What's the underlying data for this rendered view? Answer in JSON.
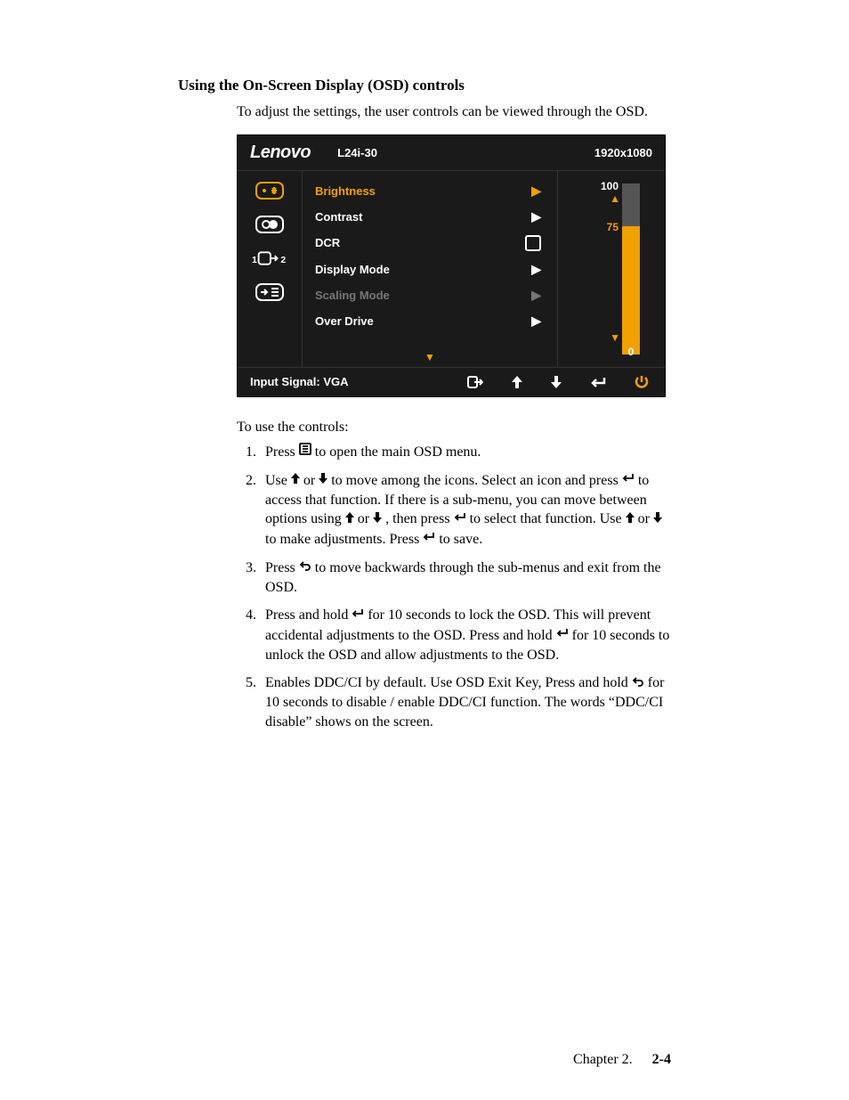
{
  "section_title": "Using the On-Screen Display (OSD) controls",
  "intro": "To adjust the settings, the user controls can be viewed through the OSD.",
  "osd": {
    "logo": "Lenovo",
    "model": "L24i-30",
    "resolution": "1920x1080",
    "menu": [
      {
        "label": "Brightness",
        "state": "selected",
        "indicator": "arrow"
      },
      {
        "label": "Contrast",
        "state": "normal",
        "indicator": "arrow"
      },
      {
        "label": "DCR",
        "state": "normal",
        "indicator": "square"
      },
      {
        "label": "Display Mode",
        "state": "normal",
        "indicator": "arrow"
      },
      {
        "label": "Scaling Mode",
        "state": "disabled",
        "indicator": "arrow"
      },
      {
        "label": "Over Drive",
        "state": "normal",
        "indicator": "arrow"
      }
    ],
    "scale": {
      "max": "100",
      "current": "75",
      "min": "0",
      "percent": 75
    },
    "footer_label": "Input Signal: VGA"
  },
  "instructions_lead": "To use the controls:",
  "instructions": {
    "i1_a": "Press ",
    "i1_b": " to open the main OSD menu.",
    "i2_a": "Use ",
    "i2_b": " or ",
    "i2_c": " to move among the icons. Select an icon and press ",
    "i2_d": " to access that function. If there is a sub-menu, you can move between options using ",
    "i2_e": " or ",
    "i2_f": " , then press ",
    "i2_g": " to select that function. Use ",
    "i2_h": " or ",
    "i2_i": " to make adjustments. Press ",
    "i2_j": " to save.",
    "i3_a": "Press ",
    "i3_b": " to move backwards through the sub-menus and exit from the OSD.",
    "i4_a": "Press and hold ",
    "i4_b": " for 10 seconds to lock the OSD. This will prevent accidental adjustments to the OSD. Press and hold ",
    "i4_c": " for 10 seconds to unlock the OSD and allow adjustments to the OSD.",
    "i5_a": "Enables DDC/CI by default. Use OSD Exit Key, Press and hold ",
    "i5_b": " for 10 seconds to disable / enable DDC/CI function. The words “DDC/CI disable” shows on the screen."
  },
  "footer": {
    "chapter": "Chapter 2.",
    "page": "2-4"
  }
}
